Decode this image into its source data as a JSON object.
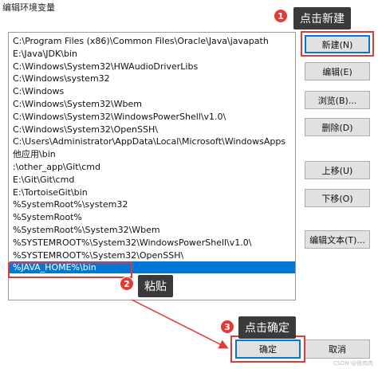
{
  "window": {
    "title": "编辑环境变量"
  },
  "paths": [
    "C:\\Program Files (x86)\\Common Files\\Oracle\\Java\\javapath",
    "E:\\Java\\JDK\\bin",
    "C:\\Windows\\System32\\HWAudioDriverLibs",
    "C:\\Windows\\system32",
    "C:\\Windows",
    "C:\\Windows\\System32\\Wbem",
    "C:\\Windows\\System32\\WindowsPowerShell\\v1.0\\",
    "C:\\Windows\\System32\\OpenSSH\\",
    "C:\\Users\\Administrator\\AppData\\Local\\Microsoft\\WindowsApps",
    "他应用\\bin",
    ":\\other_app\\Git\\cmd",
    "E:\\Git\\Git\\cmd",
    "E:\\TortoiseGit\\bin",
    "%SystemRoot%\\system32",
    "%SystemRoot%",
    "%SystemRoot%\\System32\\Wbem",
    "%SYSTEMROOT%\\System32\\WindowsPowerShell\\v1.0\\",
    "%SYSTEMROOT%\\System32\\OpenSSH\\",
    "%JAVA_HOME%\\bin"
  ],
  "selected_index": 18,
  "buttons": {
    "new": "新建(N)",
    "edit": "编辑(E)",
    "browse": "浏览(B)...",
    "delete": "删除(D)",
    "move_up": "上移(U)",
    "move_down": "下移(O)",
    "edit_text": "编辑文本(T)..."
  },
  "footer": {
    "ok": "确定",
    "cancel": "取消"
  },
  "annotations": {
    "step1": {
      "number": "1",
      "text": "点击新建"
    },
    "step2": {
      "number": "2",
      "text": "粘贴"
    },
    "step3": {
      "number": "3",
      "text": "点击确定"
    }
  },
  "watermark": "CSDN @很肉肉",
  "colors": {
    "selection": "#0078d7",
    "annotation_red": "#e53935",
    "callout_bg": "#3a3a3a"
  }
}
